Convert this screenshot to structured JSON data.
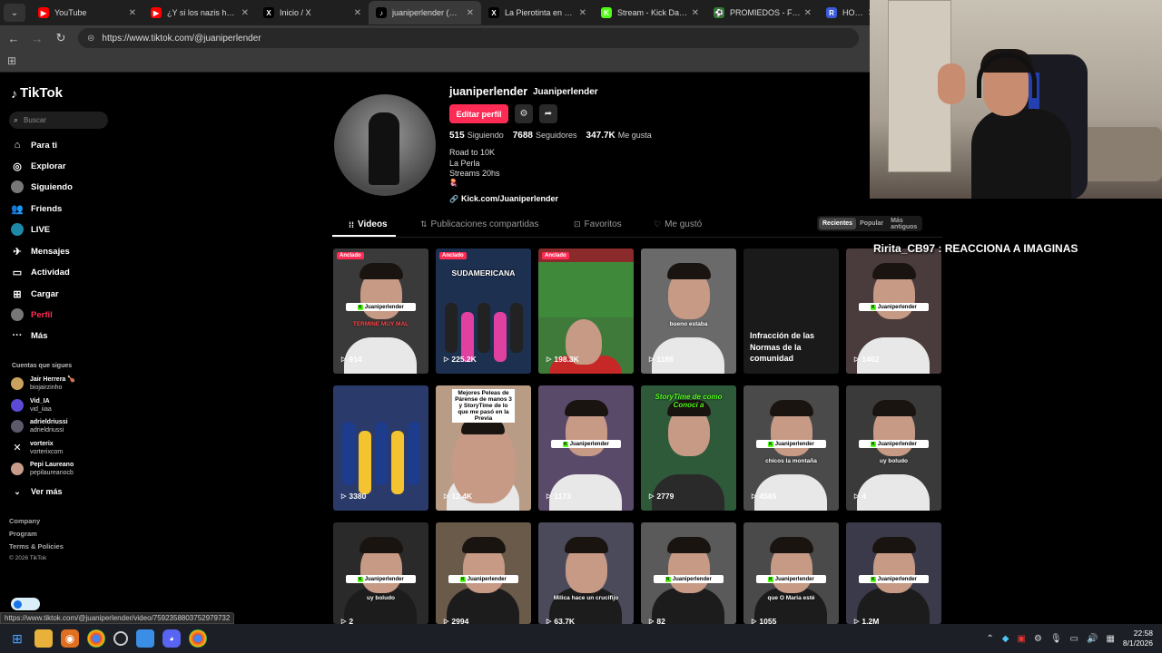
{
  "browser": {
    "tabs": [
      {
        "label": "YouTube",
        "fav": "▶",
        "fav_color": "#ff0000"
      },
      {
        "label": "¿Y si los nazis hubier",
        "fav": "▶",
        "fav_color": "#ff0000"
      },
      {
        "label": "Inicio / X",
        "fav": "X",
        "fav_color": "#000000"
      },
      {
        "label": "juaniperlender (@jua",
        "fav": "♪",
        "fav_color": "#000000"
      },
      {
        "label": "La Pierotinta en X: \"L",
        "fav": "X",
        "fav_color": "#000000"
      },
      {
        "label": "Stream - Kick Dashbo",
        "fav": "K",
        "fav_color": "#53fc18"
      },
      {
        "label": "PROMIEDOS - Futbol",
        "fav": "⚽",
        "fav_color": "#2e7d32"
      },
      {
        "label": "HOY ME PASO",
        "fav": "R",
        "fav_color": "#3b5bdb"
      }
    ],
    "url": "https://www.tiktok.com/@juaniperlender",
    "status_url": "https://www.tiktok.com/@juaniperlender/video/7592358803752979732"
  },
  "sidebar": {
    "logo": "TikTok",
    "search_placeholder": "Buscar",
    "nav": [
      {
        "label": "Para ti",
        "icon": "⌂"
      },
      {
        "label": "Explorar",
        "icon": "◎"
      },
      {
        "label": "Siguiendo",
        "icon": "●"
      },
      {
        "label": "Friends",
        "icon": "👥"
      },
      {
        "label": "LIVE",
        "icon": "●"
      },
      {
        "label": "Mensajes",
        "icon": "✈"
      },
      {
        "label": "Actividad",
        "icon": "▭"
      },
      {
        "label": "Cargar",
        "icon": "⊞"
      },
      {
        "label": "Perfil",
        "icon": "●"
      },
      {
        "label": "Más",
        "icon": "···"
      }
    ],
    "following_title": "Cuentas que sigues",
    "following": [
      {
        "name": "Jair Herrera 🍗",
        "user": "biojairzinho",
        "color": "#c9a25e"
      },
      {
        "name": "Vid_IA",
        "user": "vid_iiaa",
        "color": "#5b4bd6"
      },
      {
        "name": "adrieldriussi",
        "user": "adrieldriussi",
        "color": "#5a5a6a"
      },
      {
        "name": "vorterix",
        "user": "vorterixcom",
        "color": "#000000"
      },
      {
        "name": "Pepi Laureano",
        "user": "pepilaureanocb",
        "color": "#c89b8a"
      }
    ],
    "see_more": "Ver más",
    "footer": [
      "Company",
      "Program",
      "Terms & Policies",
      "© 2026 TikTok"
    ]
  },
  "profile": {
    "username": "juaniperlender",
    "display_name": "Juaniperlender",
    "edit_label": "Editar perfil",
    "following_count": "515",
    "following_label": "Siguiendo",
    "followers_count": "7688",
    "followers_label": "Seguidores",
    "likes_count": "347.7K",
    "likes_label": "Me gusta",
    "bio": [
      "Road to 10K",
      "La Perla",
      "Streams 20hs",
      "🪼"
    ],
    "link": "Kick.com/Juaniperlender",
    "tabs": [
      "Videos",
      "Publicaciones compartidas",
      "Favoritos",
      "Me gustó"
    ],
    "sort": [
      "Recientes",
      "Popular",
      "Más antiguos"
    ]
  },
  "videos": [
    {
      "views": "914",
      "pinned": "Anclado",
      "caption": "TERMINE MUY MAL",
      "bg": "#3a3a3a",
      "kind": "person",
      "kick_tag": "Juaniperlender"
    },
    {
      "views": "225.2K",
      "pinned": "Anclado",
      "caption": "SUDAMERICANA",
      "bg": "#1d3050",
      "kind": "football"
    },
    {
      "views": "198.3K",
      "pinned": "Anclado",
      "caption": "",
      "bg": "#3f7a3a",
      "kind": "field"
    },
    {
      "views": "1186",
      "caption": "bueno estaba",
      "bg": "#6a6a6a",
      "kind": "person"
    },
    {
      "views": "",
      "restricted": "Infracción de las Normas de la comunidad",
      "bg": "#1a1a1a",
      "kind": "restricted"
    },
    {
      "views": "1462",
      "caption": "",
      "bg": "#4a3c3c",
      "kind": "person",
      "kick_tag": "Juaniperlender"
    },
    {
      "views": "3380",
      "caption": "",
      "bg": "#2a3a6a",
      "kind": "team"
    },
    {
      "views": "12.4K",
      "caption": "Mejores Peleas de Párense de manos 3 y StoryTime de lo que me pasó en la Previa",
      "bg": "#b89c86",
      "kind": "face"
    },
    {
      "views": "1173",
      "caption": "",
      "bg": "#5a4a6a",
      "kind": "person",
      "kick_tag": "Juaniperlender"
    },
    {
      "views": "2779",
      "caption": "StoryTime de como Conocí a",
      "bg": "#2e5a3a",
      "kind": "group"
    },
    {
      "views": "4565",
      "caption": "chicos la montaña",
      "bg": "#4a4a4a",
      "kind": "person",
      "kick_tag": "Juaniperlender"
    },
    {
      "views": "4",
      "caption": "uy boludo",
      "bg": "#3a3a3a",
      "kind": "person",
      "kick_tag": "Juaniperlender"
    },
    {
      "views": "2",
      "caption": "uy boludo",
      "bg": "#2a2a2a",
      "kind": "person",
      "kick_tag": "Juaniperlender"
    },
    {
      "views": "2994",
      "caption": "",
      "bg": "#6a5a4a",
      "kind": "person",
      "kick_tag": "Juaniperlender"
    },
    {
      "views": "63.7K",
      "caption": "Milica hace un crucifijo",
      "bg": "#4a4a5a",
      "kind": "person"
    },
    {
      "views": "82",
      "caption": "",
      "bg": "#5a5a5a",
      "kind": "person",
      "kick_tag": "Juaniperlender"
    },
    {
      "views": "1055",
      "caption": "que O Maria esté",
      "bg": "#4a4a4a",
      "kind": "person",
      "kick_tag": "Juaniperlender"
    },
    {
      "views": "1.2M",
      "caption": "",
      "bg": "#3a3a4a",
      "kind": "person",
      "kick_tag": "Juaniperlender"
    }
  ],
  "stream_overlay": "Ririta_CB97 : REACCIONA A IMAGINAS",
  "taskbar": {
    "time": "22:58",
    "date": "8/1/2026"
  }
}
